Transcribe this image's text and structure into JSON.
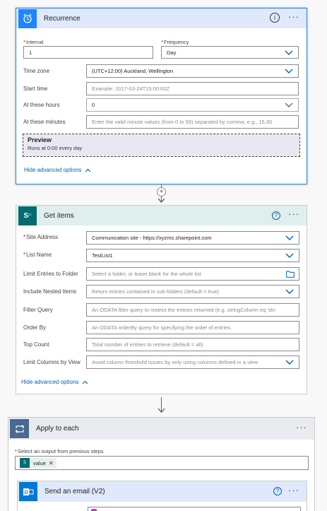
{
  "recurrence": {
    "title": "Recurrence",
    "interval": {
      "label": "Interval",
      "value": "1"
    },
    "frequency": {
      "label": "Frequency",
      "value": "Day"
    },
    "time_zone": {
      "label": "Time zone",
      "value": "(UTC+12:00) Auckland, Wellington"
    },
    "start_time": {
      "label": "Start time",
      "placeholder": "Example: 2017-03-24T15:00:00Z"
    },
    "at_these_hours": {
      "label": "At these hours",
      "value": "0"
    },
    "at_these_minutes": {
      "label": "At these minutes",
      "placeholder": "Enter the valid minute values (from 0 to 59) separated by comma, e.g., 15,30"
    },
    "preview": {
      "title": "Preview",
      "text": "Runs at 0:00 every day"
    },
    "hide_advanced": "Hide advanced options"
  },
  "get_items": {
    "title": "Get items",
    "site_address": {
      "label": "Site Address",
      "value": "Communication site - https://xyzms.sharepoint.com"
    },
    "list_name": {
      "label": "List Name",
      "value": "TestList1"
    },
    "limit_folder": {
      "label": "Limit Entries to Folder",
      "placeholder": "Select a folder, or leave blank for the whole list"
    },
    "nested_items": {
      "label": "Include Nested Items",
      "placeholder": "Return entries contained in sub-folders (default = true)"
    },
    "filter_query": {
      "label": "Filter Query",
      "placeholder": "An ODATA filter query to restrict the entries returned (e.g. stringColumn eq 'stri"
    },
    "order_by": {
      "label": "Order By",
      "placeholder": "An ODATA orderBy query for specifying the order of entries."
    },
    "top_count": {
      "label": "Top Count",
      "placeholder": "Total number of entries to retrieve (default = all)."
    },
    "limit_columns": {
      "label": "Limit Columns by View",
      "placeholder": "Avoid column threshold issues by only using columns defined in a view"
    },
    "hide_advanced": "Hide advanced options"
  },
  "apply_to_each": {
    "title": "Apply to each",
    "select_label": "Select an output from previous steps",
    "token": "value"
  },
  "send_email": {
    "title": "Send an email (V2)"
  },
  "colors": {
    "accent": "#0063b1",
    "recurrence_header": "#dfe9fb",
    "sharepoint_header": "#e0eeee",
    "sharepoint_icon": "#036c70",
    "apply_header": "#e9ebf0",
    "apply_icon": "#486991",
    "outlook_header": "#dfe9fb",
    "outlook_icon": "#0078d4",
    "required": "#cc0000"
  },
  "icons": [
    "alarm-clock-icon",
    "info-icon",
    "more-options-icon",
    "chevron-down-icon",
    "chevron-up-icon",
    "add-step-icon",
    "sharepoint-icon",
    "help-icon",
    "folder-icon",
    "loop-icon",
    "token-remove-icon",
    "outlook-icon"
  ]
}
